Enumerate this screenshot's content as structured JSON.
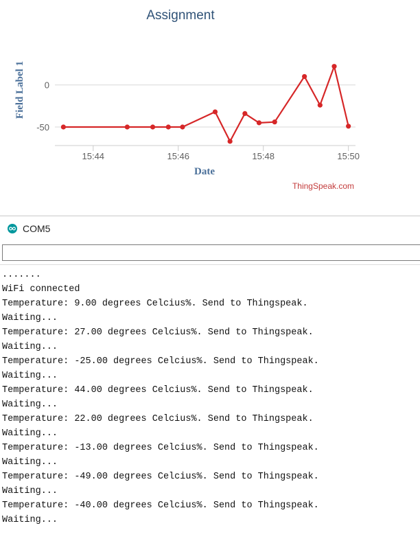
{
  "chart": {
    "credit": "ThingSpeak.com"
  },
  "chart_data": {
    "type": "line",
    "title": "Assignment",
    "xlabel": "Date",
    "ylabel": "Field Label 1",
    "x_tick_labels": [
      "15:44",
      "15:46",
      "15:48",
      "15:50"
    ],
    "x_ticks": [
      "15:44",
      "15:46",
      "15:48",
      "15:50"
    ],
    "y_tick_labels": [
      "0",
      "-50"
    ],
    "y_ticks": [
      0,
      -50
    ],
    "xlim": [
      "15:43:06",
      "15:50:10"
    ],
    "ylim": [
      -72,
      56
    ],
    "grid": true,
    "legend": "none",
    "series": [
      {
        "color": "#d62728",
        "x": [
          "15:43:18",
          "15:44:48",
          "15:45:24",
          "15:45:46",
          "15:46:06",
          "15:46:52",
          "15:47:13",
          "15:47:34",
          "15:47:54",
          "15:48:16",
          "15:48:58",
          "15:49:20",
          "15:49:40",
          "15:50:00"
        ],
        "y": [
          -50,
          -50,
          -50,
          -50,
          -50,
          -32,
          -67,
          -34,
          -45,
          -44,
          10,
          -24,
          22,
          -49
        ]
      }
    ]
  },
  "serial": {
    "window_title": "COM5",
    "send_input_value": "",
    "output_lines": [
      ".......",
      "WiFi connected",
      "Temperature: 9.00 degrees Celcius%. Send to Thingspeak.",
      "Waiting...",
      "Temperature: 27.00 degrees Celcius%. Send to Thingspeak.",
      "Waiting...",
      "Temperature: -25.00 degrees Celcius%. Send to Thingspeak.",
      "Waiting...",
      "Temperature: 44.00 degrees Celcius%. Send to Thingspeak.",
      "Waiting...",
      "Temperature: 22.00 degrees Celcius%. Send to Thingspeak.",
      "Waiting...",
      "Temperature: -13.00 degrees Celcius%. Send to Thingspeak.",
      "Waiting...",
      "Temperature: -49.00 degrees Celcius%. Send to Thingspeak.",
      "Waiting...",
      "Temperature: -40.00 degrees Celcius%. Send to Thingspeak.",
      "Waiting..."
    ]
  },
  "icons": {
    "window_icon": "arduino-icon"
  },
  "colors": {
    "series_line": "#d62728",
    "title_text": "#2f5277",
    "axis_title_text": "#4a6f99",
    "credit_text": "#c33b3b",
    "icon_teal": "#00979d"
  }
}
